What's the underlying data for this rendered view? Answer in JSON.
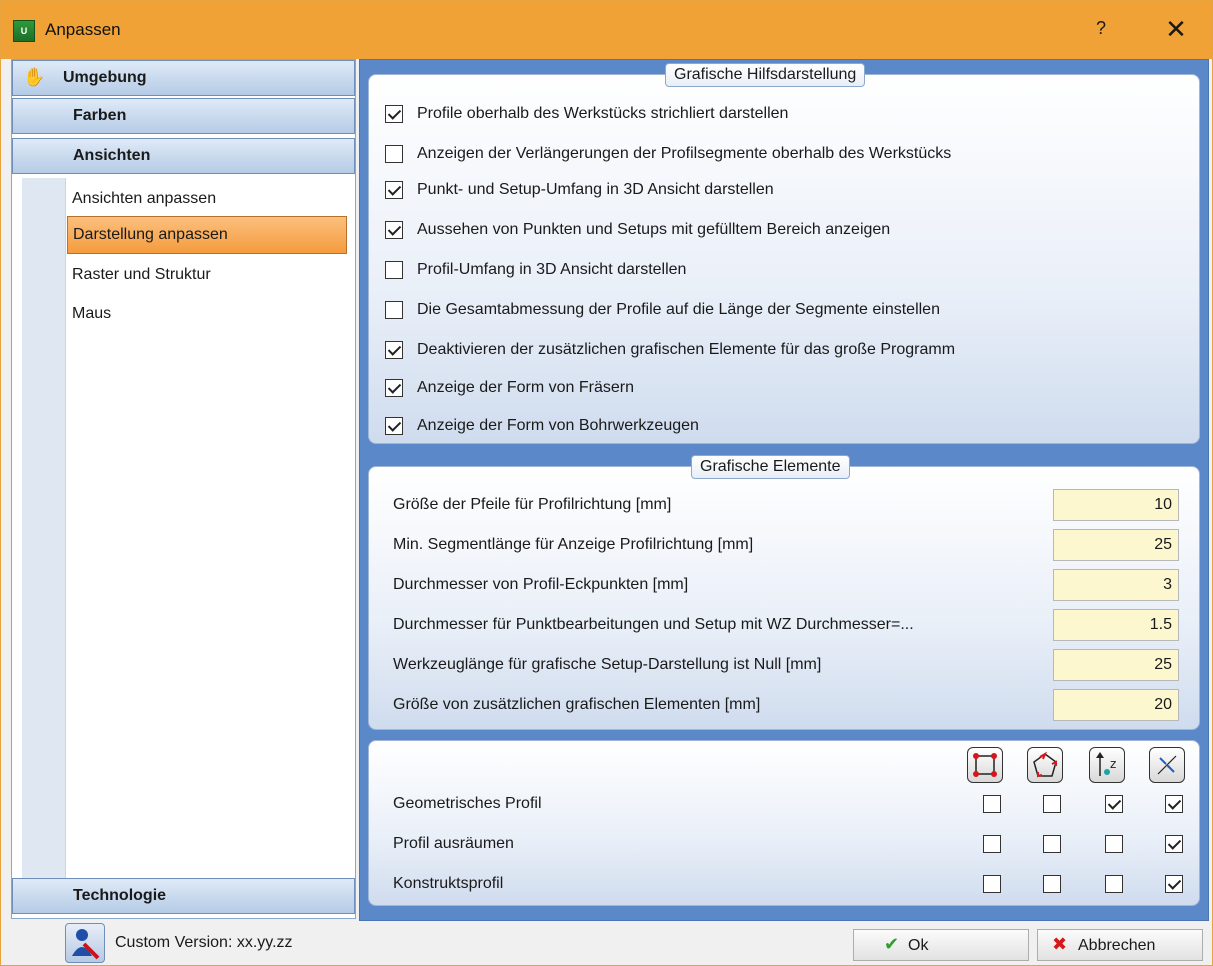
{
  "window": {
    "title": "Anpassen",
    "help_label": "?",
    "close_label": "✕",
    "app_icon_text": "U"
  },
  "nav": {
    "top_section": "Umgebung",
    "sections": [
      "Farben",
      "Ansichten"
    ],
    "items": [
      {
        "label": "Ansichten anpassen",
        "selected": false
      },
      {
        "label": "Darstellung anpassen",
        "selected": true
      },
      {
        "label": "Raster und Struktur",
        "selected": false
      },
      {
        "label": "Maus",
        "selected": false
      }
    ],
    "bottom_section": "Technologie"
  },
  "group1": {
    "legend": "Grafische Hilfsdarstellung",
    "options": [
      {
        "label": "Profile oberhalb des Werkstücks strichliert darstellen",
        "checked": true
      },
      {
        "label": "Anzeigen der Verlängerungen der Profilsegmente oberhalb des Werkstücks",
        "checked": false
      },
      {
        "label": "Punkt- und Setup-Umfang in 3D Ansicht darstellen",
        "checked": true
      },
      {
        "label": "Aussehen von Punkten und Setups mit gefülltem Bereich anzeigen",
        "checked": true
      },
      {
        "label": "Profil-Umfang in 3D Ansicht darstellen",
        "checked": false
      },
      {
        "label": "Die Gesamtabmessung der Profile auf die Länge der Segmente einstellen",
        "checked": false
      },
      {
        "label": "Deaktivieren der zusätzlichen grafischen Elemente für das große Programm",
        "checked": true
      },
      {
        "label": "Anzeige der Form von Fräsern",
        "checked": true
      },
      {
        "label": "Anzeige der Form von Bohrwerkzeugen",
        "checked": true
      }
    ]
  },
  "group2": {
    "legend": "Grafische Elemente",
    "fields": [
      {
        "label": "Größe der Pfeile für Profilrichtung [mm]",
        "value": "10"
      },
      {
        "label": "Min. Segmentlänge für Anzeige Profilrichtung [mm]",
        "value": "25"
      },
      {
        "label": "Durchmesser von Profil-Eckpunkten [mm]",
        "value": "3"
      },
      {
        "label": "Durchmesser für Punktbearbeitungen und  Setup mit WZ Durchmesser=...",
        "value": "1.5"
      },
      {
        "label": "Werkzeuglänge für grafische Setup-Darstellung ist Null [mm]",
        "value": "25"
      },
      {
        "label": "Größe von zusätzlichen grafischen Elementen [mm]",
        "value": "20"
      }
    ]
  },
  "group3": {
    "columns": [
      "corner-points-icon",
      "profile-direction-icon",
      "tool-z-icon",
      "arrows-in-icon"
    ],
    "rows": [
      {
        "label": "Geometrisches Profil",
        "checks": [
          false,
          false,
          true,
          true
        ]
      },
      {
        "label": "Profil ausräumen",
        "checks": [
          false,
          false,
          false,
          true
        ]
      },
      {
        "label": "Konstruktsprofil",
        "checks": [
          false,
          false,
          false,
          true
        ]
      }
    ]
  },
  "footer": {
    "version": "Custom Version: xx.yy.zz",
    "ok_label": "Ok",
    "cancel_label": "Abbrechen"
  },
  "colors": {
    "titlebar": "#f0a236",
    "selected_item": "#f59c3e",
    "content_bg": "#5b88c9",
    "input_bg": "#fdf7d0"
  }
}
